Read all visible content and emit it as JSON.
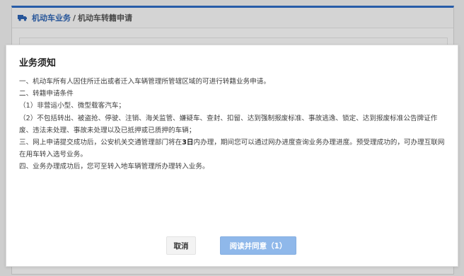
{
  "breadcrumb": {
    "icon": "truck-icon",
    "main": "机动车业务",
    "separator": "/",
    "sub": "机动车转籍申请"
  },
  "modal": {
    "title": "业务须知",
    "lines": [
      "一、机动车所有人因住所迁出或者迁入车辆管理所管辖区域的可进行转籍业务申请。",
      "二、转籍申请条件",
      "（1）非营运小型、微型载客汽车；",
      "（2）不包括转出、被盗抢、停驶、注销、海关监管、嫌疑车、查封、扣留、达到强制报废标准、事故逃逸、锁定、达到报废标准公告牌证作废、违法未处理、事故未处理以及已抵押或已质押的车辆；",
      "三、网上申请提交成功后，公安机关交通管理部门将在",
      "3日",
      "内办理，期间您可以通过网办进度查询业务办理进度。预受理成功的，可办理互联网在用车转入选号业务。",
      "四、业务办理成功后，您可至转入地车辆管理所办理转入业务。"
    ],
    "cancel_label": "取消",
    "agree_label": "阅读并同意（1）"
  },
  "colors": {
    "accent": "#2e6cc4",
    "agree_button": "#8fb8ea"
  }
}
